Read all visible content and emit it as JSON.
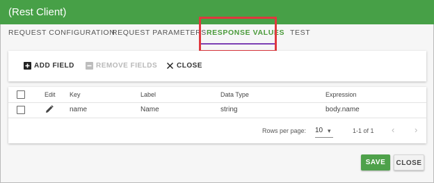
{
  "window": {
    "title": "(Rest Client)"
  },
  "tabs": [
    {
      "label": "REQUEST CONFIGURATION"
    },
    {
      "label": "REQUEST PARAMETERS"
    },
    {
      "label": "RESPONSE VALUES"
    },
    {
      "label": "TEST"
    }
  ],
  "active_tab": "RESPONSE VALUES",
  "toolbar": {
    "add_field": "ADD FIELD",
    "remove_fields": "REMOVE FIELDS",
    "close": "CLOSE"
  },
  "table": {
    "columns": [
      "Edit",
      "Key",
      "Label",
      "Data Type",
      "Expression"
    ],
    "rows": [
      {
        "key": "name",
        "label": "Name",
        "data_type": "string",
        "expression": "body.name"
      }
    ]
  },
  "pagination": {
    "rows_per_page_label": "Rows per page:",
    "rows_per_page": "10",
    "range": "1-1 of 1"
  },
  "footer": {
    "save": "SAVE",
    "close": "CLOSE"
  },
  "colors": {
    "title_bar": "#47a047",
    "active_tab": "#4a9a3a",
    "tab_underline": "#7b3fb3",
    "highlight": "#e0383e",
    "save": "#4ea14a"
  }
}
